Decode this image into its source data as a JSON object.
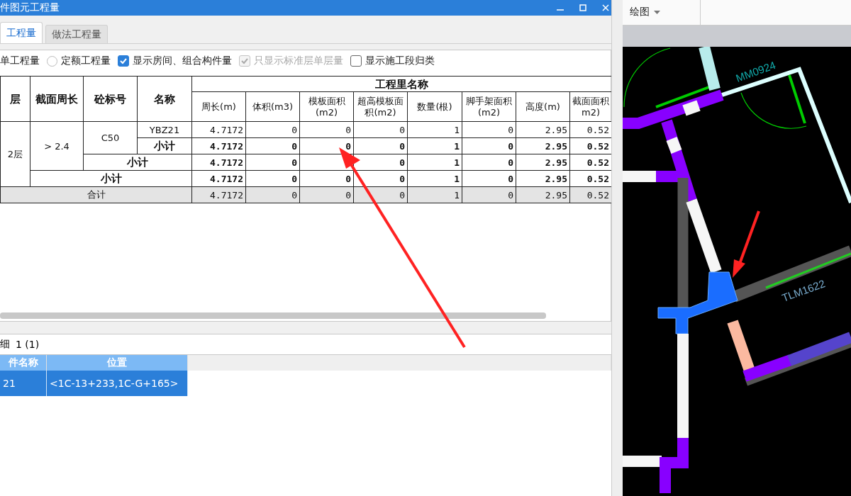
{
  "window": {
    "title": "件图元工程量"
  },
  "tabs": [
    {
      "label": "工程量",
      "selected": true
    },
    {
      "label": "做法工程量",
      "selected": false
    }
  ],
  "options": [
    {
      "kind": "label",
      "label": "单工程量"
    },
    {
      "kind": "radio",
      "label": "定额工程量",
      "checked": false
    },
    {
      "kind": "checkbox",
      "label": "显示房间、组合构件量",
      "checked": true,
      "disabled": false
    },
    {
      "kind": "checkbox",
      "label": "只显示标准层单层量",
      "checked": true,
      "disabled": true
    },
    {
      "kind": "checkbox",
      "label": "显示施工段归类",
      "checked": false,
      "disabled": false
    }
  ],
  "table": {
    "columns": [
      "层",
      "截面周长",
      "砼标号",
      "名称"
    ],
    "group_header": "工程里名称",
    "quantity_columns": [
      "周长(m)",
      "体积(m3)",
      "模板面积(m2)",
      "超高模板面积(m2)",
      "数量(根)",
      "脚手架面积(m2)",
      "高度(m)",
      "截面面积m2)"
    ],
    "rows": [
      {
        "kind": "item",
        "cells": [
          {
            "text": "2层",
            "rowspan": 4
          },
          {
            "text": "> 2.4",
            "rowspan": 3
          },
          {
            "text": "C50",
            "rowspan": 2
          },
          {
            "text": "YBZ21"
          }
        ],
        "values": [
          "4.7172",
          "0",
          "0",
          "0",
          "1",
          "0",
          "2.95",
          "0.52"
        ]
      },
      {
        "kind": "subtotal",
        "cells": [
          {
            "text": "小计"
          }
        ],
        "values": [
          "4.7172",
          "0",
          "0",
          "0",
          "1",
          "0",
          "2.95",
          "0.52"
        ]
      },
      {
        "kind": "subtotal",
        "cells": [
          {
            "text": "小计",
            "colspan": 2
          }
        ],
        "values": [
          "4.7172",
          "0",
          {
            "kind": "covered"
          },
          "0",
          "1",
          "0",
          "2.95",
          "0.52"
        ]
      },
      {
        "kind": "subtotal",
        "cells": [
          {
            "text": "小计",
            "colspan": 3
          }
        ],
        "values": [
          "4.7172",
          "0",
          "0",
          "0",
          "1",
          "0",
          "2.95",
          "0.52"
        ]
      },
      {
        "kind": "total",
        "cells": [
          {
            "text": "合计",
            "colspan": 4
          }
        ],
        "values": [
          "4.7172",
          "0",
          "0",
          "0",
          "1",
          "0",
          "2.95",
          "0.52"
        ]
      }
    ]
  },
  "detail": {
    "title": "细",
    "count": "1 (1)",
    "columns": [
      "件名称",
      "位置"
    ],
    "rows": [
      {
        "cells": [
          "21",
          "<1C-13+233,1C-G+165>"
        ],
        "selected": true
      }
    ]
  },
  "toolbar": {
    "menu": "绘图"
  },
  "drawing": {
    "labels": [
      "MM0924",
      "TLM1622"
    ]
  }
}
